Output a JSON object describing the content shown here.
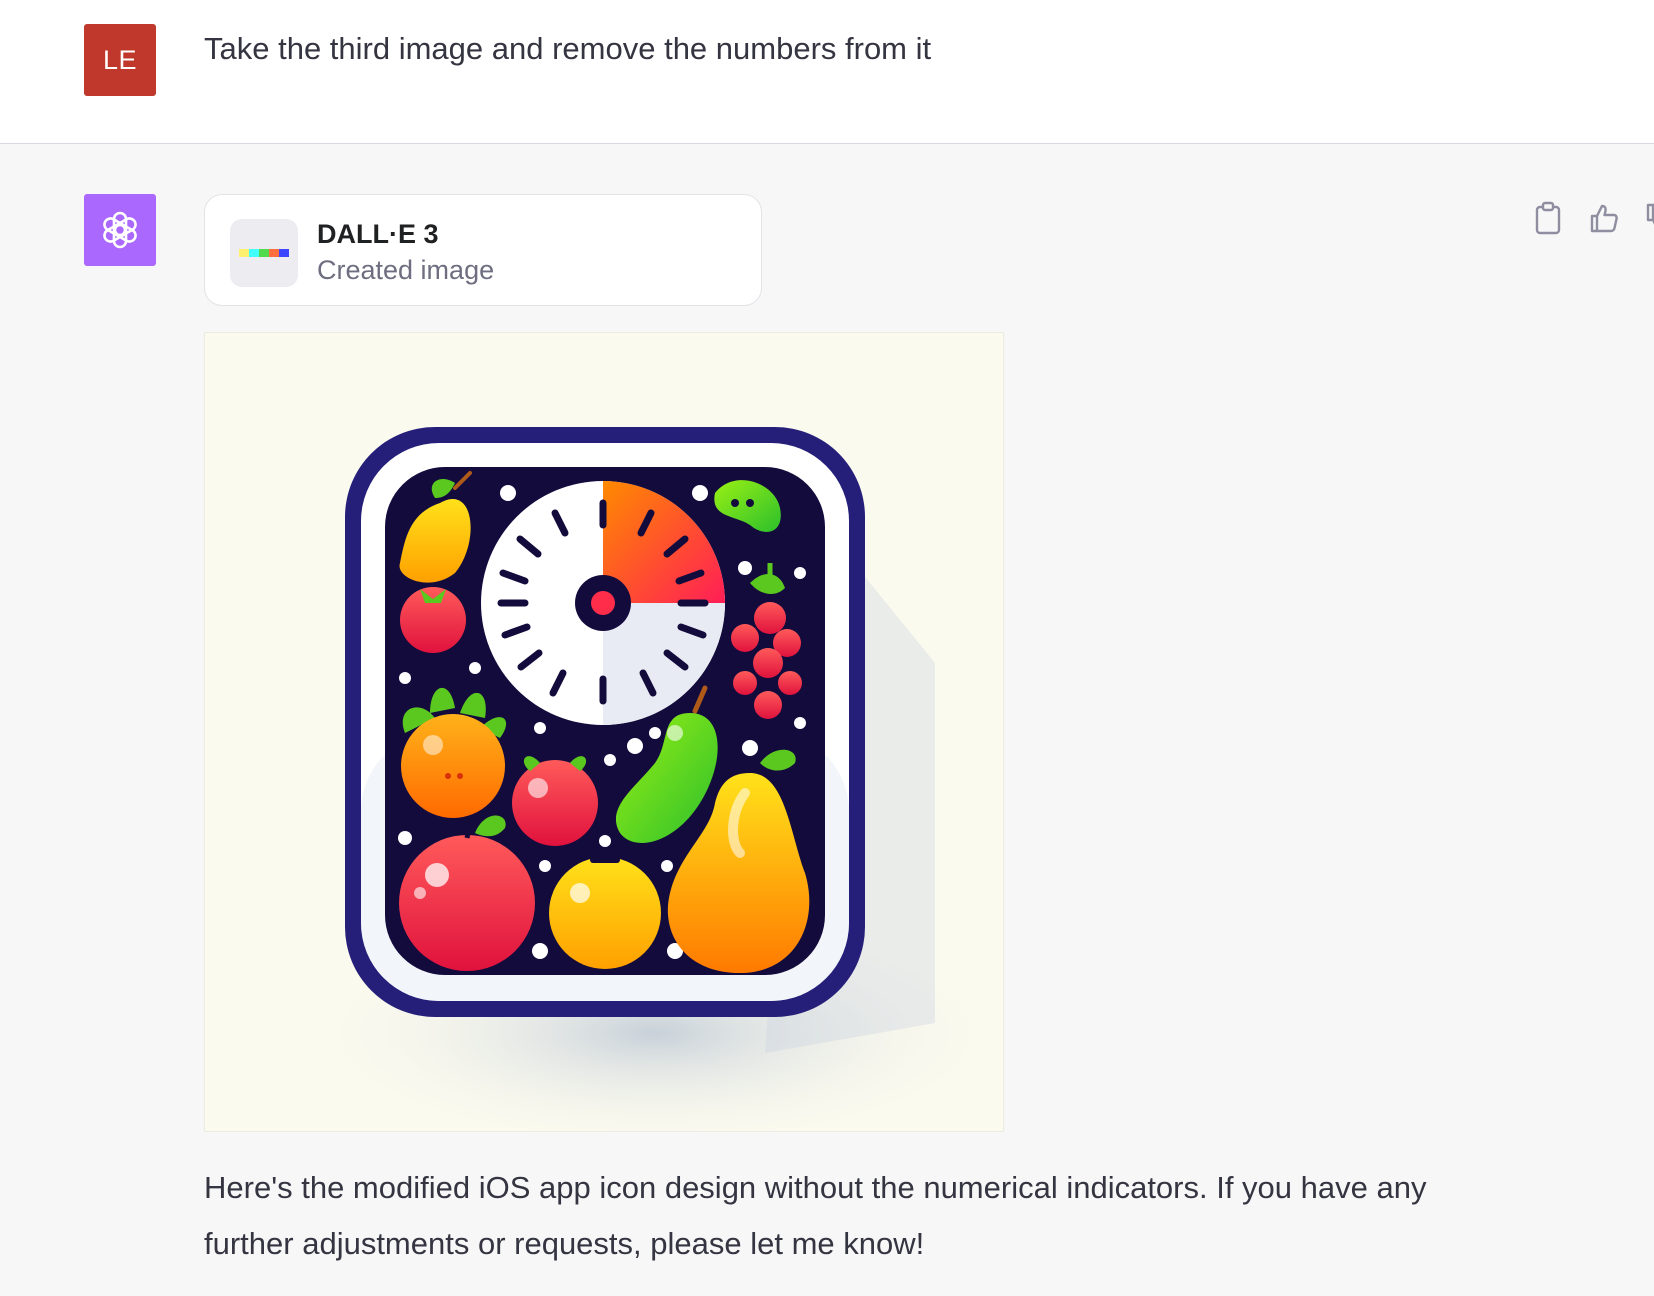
{
  "user_message": {
    "avatar_initials": "LE",
    "text": "Take the third image and remove the numbers from it"
  },
  "assistant": {
    "avatar_icon": "openai-logo-icon",
    "tool": {
      "name": "DALL·E 3",
      "status": "Created image",
      "icon": "dalle-color-strip-icon"
    },
    "generated_image": {
      "subject": "fruit-app-icon-image"
    },
    "actions": [
      {
        "icon": "clipboard-icon"
      },
      {
        "icon": "thumbs-up-icon"
      },
      {
        "icon": "thumbs-down-icon"
      }
    ],
    "response_text": "Here's the modified iOS app icon design without the numerical indicators. If you have any further adjustments or requests, please let me know!"
  },
  "colors": {
    "user_avatar": "#c0382b",
    "assistant_avatar": "#ab68ff",
    "user_row_bg": "#ffffff",
    "assistant_row_bg": "#f7f7f8"
  }
}
